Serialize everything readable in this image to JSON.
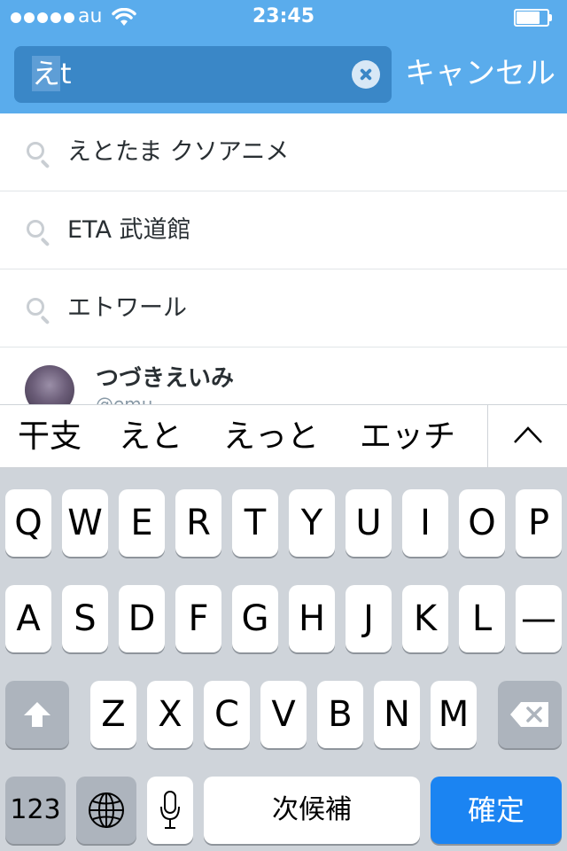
{
  "status_bar": {
    "carrier": "au",
    "time": "23:45"
  },
  "search": {
    "query_marked": "え",
    "query_rest": "t",
    "cancel_label": "キャンセル"
  },
  "suggestions": [
    {
      "label": "えとたま クソアニメ",
      "icon": "search-icon"
    },
    {
      "label": "ETA 武道館",
      "icon": "search-icon"
    },
    {
      "label": "エトワール",
      "icon": "search-icon"
    }
  ],
  "user_result": {
    "name": "つづきえいみ",
    "handle": "@emu..."
  },
  "candidates": [
    "干支",
    "えと",
    "えっと",
    "エッチ"
  ],
  "keyboard": {
    "row1": [
      "Q",
      "W",
      "E",
      "R",
      "T",
      "Y",
      "U",
      "I",
      "O",
      "P"
    ],
    "row2": [
      "A",
      "S",
      "D",
      "F",
      "G",
      "H",
      "J",
      "K",
      "L",
      "—"
    ],
    "row3": [
      "Z",
      "X",
      "C",
      "V",
      "B",
      "N",
      "M"
    ],
    "numbers_label": "123",
    "space_label": "次候補",
    "return_label": "確定"
  },
  "colors": {
    "header": "#5aacec",
    "search_field": "#3a87c7",
    "return_key": "#1b84f2",
    "keyboard_bg": "#cfd4da"
  }
}
